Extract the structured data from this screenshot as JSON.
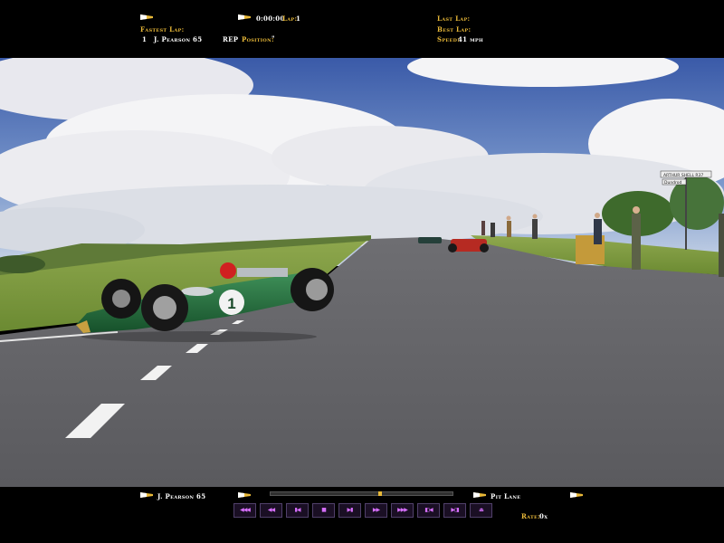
{
  "hud": {
    "fastest_lap_label": "Fastest Lap:",
    "fastest_lap_pos": "1",
    "fastest_lap_driver": "J. Pearson 65",
    "rep_label": "REP",
    "position_label": "Position:",
    "position_value": "\"",
    "time": "0:00:00",
    "lap_label": "Lap:",
    "lap_value": "1",
    "last_lap_label": "Last Lap:",
    "best_lap_label": "Best Lap:",
    "speed_label": "Speed:",
    "speed_value": "41 mph"
  },
  "scene": {
    "car_number": "1",
    "sign_top": "ARTHUR SHELL R37",
    "sign_bottom": "Dundrod"
  },
  "replay": {
    "driver": "J. Pearson 65",
    "pit_lane_label": "Pit Lane",
    "rate_label": "Rate:",
    "rate_value": "0x",
    "timeline_progress": 0.6,
    "buttons": [
      {
        "name": "skip-to-start",
        "glyph": "◀◀◀"
      },
      {
        "name": "rewind",
        "glyph": "◀◀"
      },
      {
        "name": "step-back",
        "glyph": "▮◀"
      },
      {
        "name": "pause",
        "glyph": "▮▮"
      },
      {
        "name": "step-forward",
        "glyph": "▶▮"
      },
      {
        "name": "fast-forward",
        "glyph": "▶▶"
      },
      {
        "name": "skip-to-end",
        "glyph": "▶▶▶"
      },
      {
        "name": "camera-prev",
        "glyph": "◧◀"
      },
      {
        "name": "camera-next",
        "glyph": "▶◨"
      },
      {
        "name": "eject",
        "glyph": "⏏"
      }
    ]
  },
  "colors": {
    "label_gold": "#e8b838",
    "button_glyph": "#d870ff",
    "car_green": "#1f6b3a"
  }
}
